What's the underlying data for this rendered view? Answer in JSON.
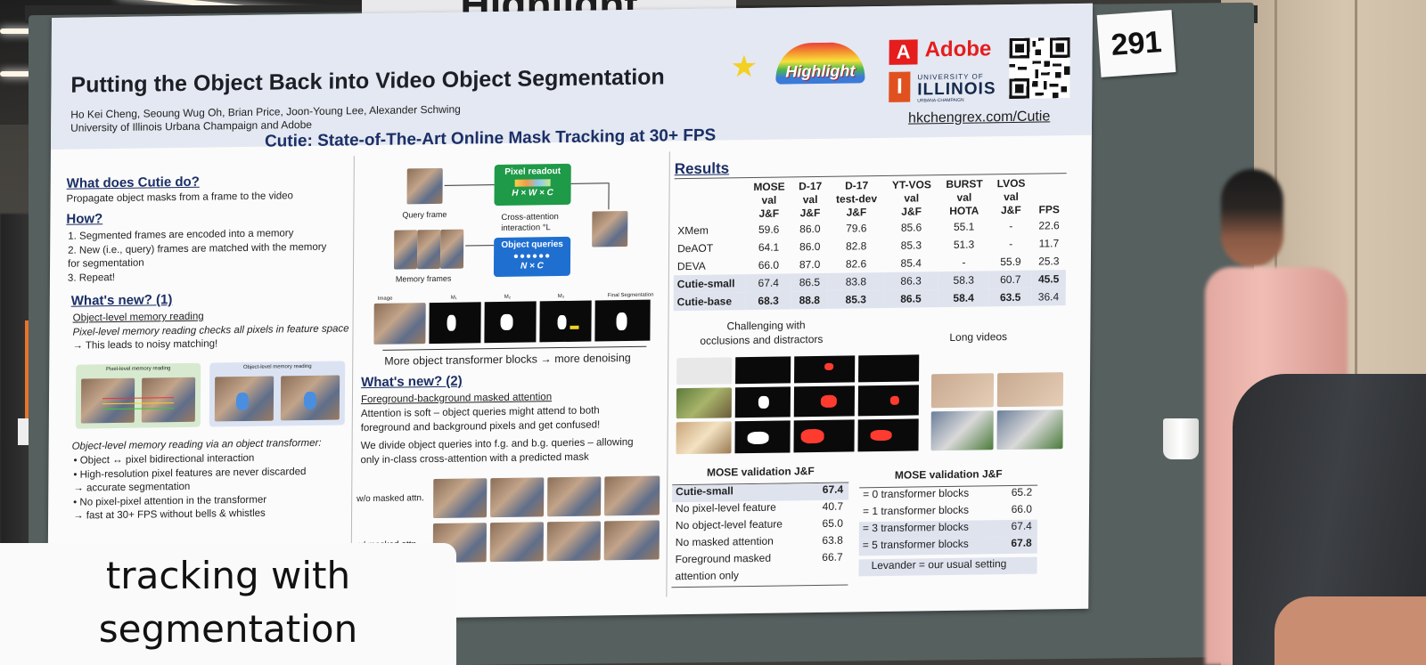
{
  "photo": {
    "banner_text": "Highlight",
    "board_number": "291"
  },
  "poster": {
    "title": "Putting the Object Back into Video Object Segmentation",
    "authors": "Ho Kei Cheng, Seoung Wug Oh, Brian Price, Joon-Young Lee, Alexander Schwing",
    "affiliation": "University of Illinois Urbana Champaign and Adobe",
    "subtitle": "Cutie: State-of-The-Art Online Mask Tracking at 30+ FPS",
    "highlight_logo": "Highlight",
    "adobe": "Adobe",
    "univ_of": "UNIVERSITY OF",
    "illinois": "ILLINOIS",
    "urbana": "URBANA-CHAMPAIGN",
    "url": "hkchengrex.com/Cutie",
    "left": {
      "what_title": "What does Cutie do?",
      "what_text": "Propagate object masks from a frame to the video",
      "how_title": "How?",
      "how_items": [
        "1.   Segmented frames are encoded into a memory",
        "2.   New (i.e., query) frames are matched with the memory",
        "      for segmentation",
        "3.   Repeat!"
      ],
      "new1_title": "What's new? (1)",
      "new1_sub": "Object-level memory reading",
      "new1_text1": "Pixel-level memory reading checks all pixels in feature space",
      "new1_text2": "→ This leads to noisy matching!",
      "fig_label_a": "Pixel-level memory reading",
      "fig_label_b": "Object-level memory reading",
      "obj_intro": "Object-level memory reading via an object transformer:",
      "obj_items": [
        "•   Object ↔ pixel bidirectional interaction",
        "•   High-resolution pixel features are never discarded",
        "       → accurate segmentation",
        "•   No pixel-pixel attention in the transformer",
        "       → fast at 30+ FPS without bells & whistles"
      ]
    },
    "middle": {
      "query_frame": "Query frame",
      "memory_frames": "Memory frames",
      "pixel_readout": "Pixel readout",
      "pixel_dims": "H × W × C",
      "cross_attn": "Cross-attention",
      "interaction": "interaction °L",
      "object_queries": "Object queries",
      "oq_dims": "N × C",
      "strip_labels": [
        "Image",
        "M₁",
        "M₂",
        "M₃",
        "Final Segmentation"
      ],
      "denoise_caption": "More object transformer blocks → more denoising",
      "new2_title": "What's new? (2)",
      "new2_sub": "Foreground-background masked attention",
      "new2_text": [
        "Attention is soft – object queries might attend to both",
        "foreground and background pixels and get confused!",
        "We divide object queries into f.g. and b.g. queries – allowing",
        "only in-class cross-attention with a predicted mask"
      ],
      "wo_masked": "w/o masked attn.",
      "w_masked": "w/ masked attn."
    },
    "results": {
      "title": "Results",
      "columns": [
        "",
        "MOSE\nval\nJ&F",
        "D-17\nval\nJ&F",
        "D-17\ntest-dev\nJ&F",
        "YT-VOS\nval\nJ&F",
        "BURST\nval\nHOTA",
        "LVOS\nval\nJ&F",
        "FPS"
      ],
      "rows": [
        [
          "XMem",
          "59.6",
          "86.0",
          "79.6",
          "85.6",
          "55.1",
          "-",
          "22.6"
        ],
        [
          "DeAOT",
          "64.1",
          "86.0",
          "82.8",
          "85.3",
          "51.3",
          "-",
          "11.7"
        ],
        [
          "DEVA",
          "66.0",
          "87.0",
          "82.6",
          "85.4",
          "-",
          "55.9",
          "25.3"
        ],
        [
          "Cutie-small",
          "67.4",
          "86.5",
          "83.8",
          "86.3",
          "58.3",
          "60.7",
          "45.5"
        ],
        [
          "Cutie-base",
          "68.3",
          "88.8",
          "85.3",
          "86.5",
          "58.4",
          "63.5",
          "36.4"
        ]
      ],
      "challenging": "Challenging with",
      "challenging2": "occlusions and distractors",
      "long_videos": "Long videos"
    },
    "ablation1": {
      "title": "MOSE validation J&F",
      "rows": [
        [
          "Cutie-small",
          "67.4"
        ],
        [
          "No pixel-level feature",
          "40.7"
        ],
        [
          "No object-level feature",
          "65.0"
        ],
        [
          "No masked attention",
          "63.8"
        ],
        [
          "Foreground masked",
          "66.7"
        ]
      ],
      "last_extra": "attention only"
    },
    "ablation2": {
      "title": "MOSE validation J&F",
      "rows": [
        [
          "= 0 transformer blocks",
          "65.2"
        ],
        [
          "= 1 transformer blocks",
          "66.0"
        ],
        [
          "= 3 transformer blocks",
          "67.4"
        ],
        [
          "= 5 transformer blocks",
          "67.8"
        ]
      ],
      "note": "Levander = our usual setting"
    }
  },
  "caption": {
    "line1": "tracking with",
    "line2": "segmentation"
  },
  "colors": {
    "poster_title": "#1d1f25",
    "section_blue": "#1b2f66",
    "adobe_red": "#e51d1d",
    "node_green": "#1e9a48",
    "node_blue": "#1f6fd1"
  }
}
